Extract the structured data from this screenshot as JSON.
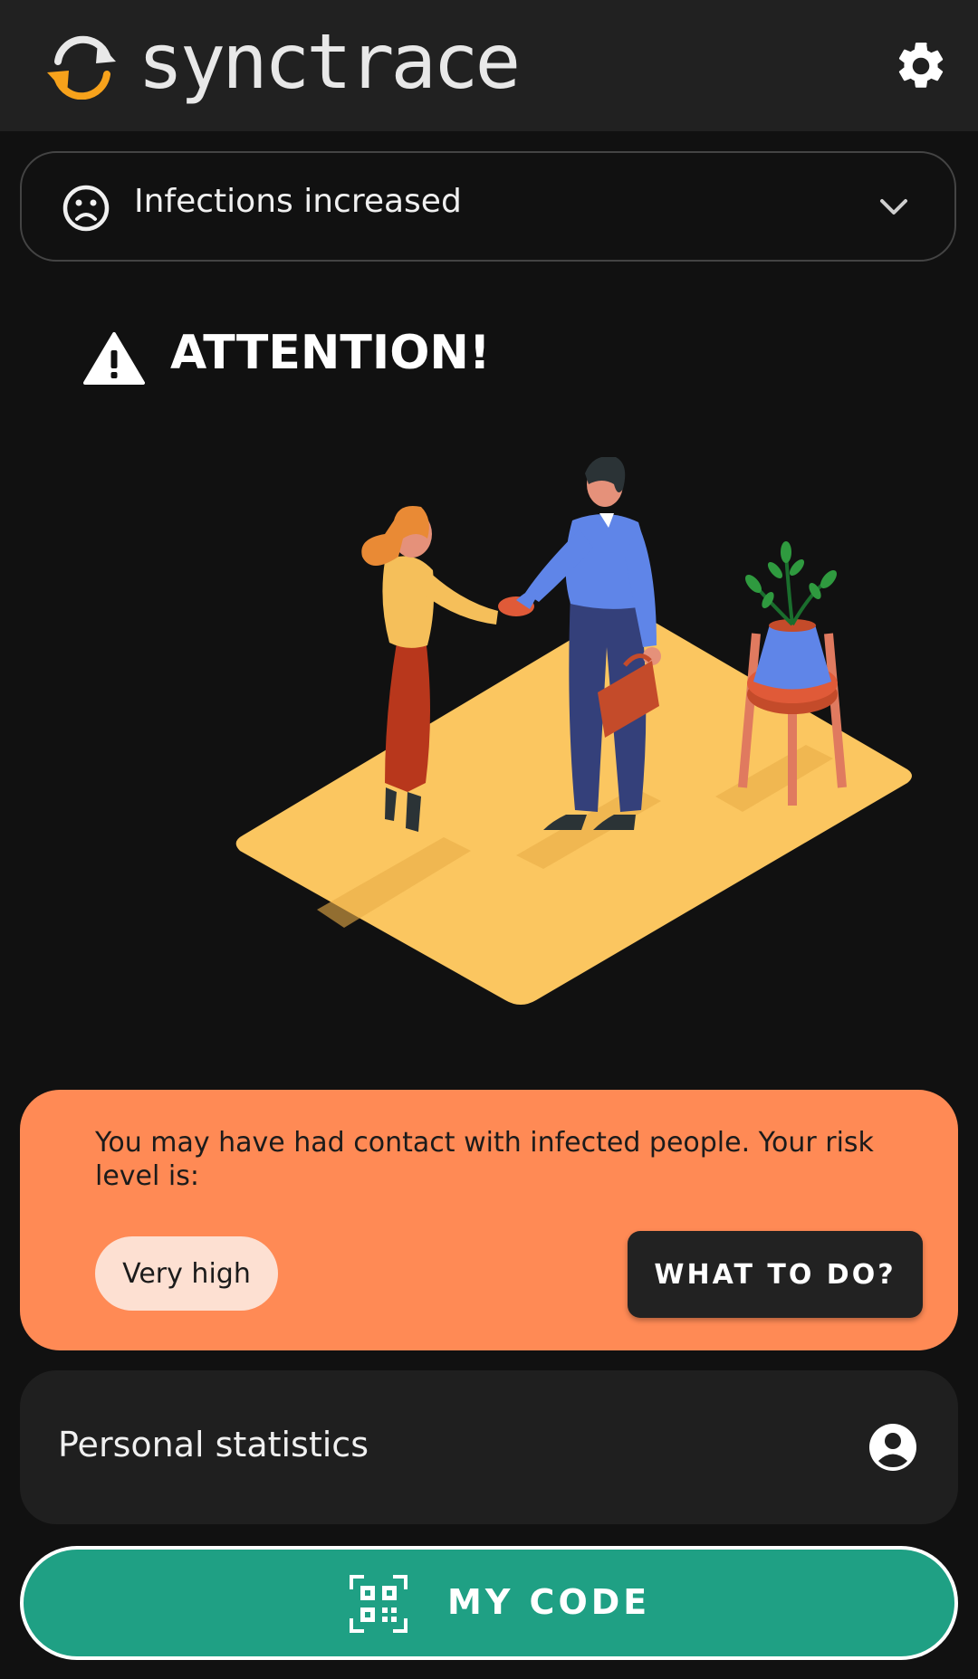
{
  "app": {
    "brand": "synctrace",
    "colors": {
      "logo_accent": "#f7a21b",
      "risk_card": "#ff8a55",
      "my_code_button": "#1fa084"
    }
  },
  "header": {
    "settings_icon": "gear-icon"
  },
  "status": {
    "icon": "sad-face-icon",
    "label": "Infections increased",
    "expand_icon": "chevron-down-icon"
  },
  "alert": {
    "icon": "warning-triangle-icon",
    "title": "ATTENTION!"
  },
  "risk": {
    "message": "You may have had contact with infected people. Your risk level is:",
    "level": "Very high",
    "action_label": "WHAT TO DO?"
  },
  "stats": {
    "label": "Personal statistics",
    "icon": "account-circle-icon"
  },
  "my_code": {
    "label": "MY CODE",
    "icon": "qr-code-icon"
  }
}
